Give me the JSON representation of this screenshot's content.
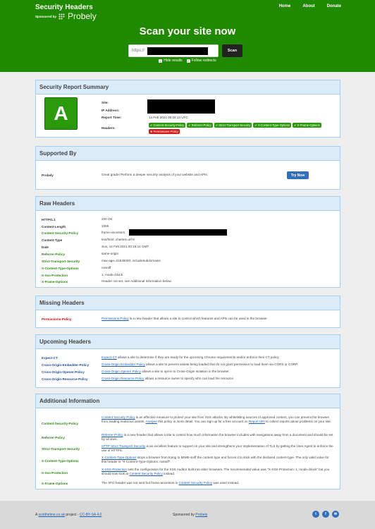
{
  "brand": {
    "title": "Security Headers",
    "sponsored": "Sponsored by",
    "probely": "Probely"
  },
  "nav": [
    "Home",
    "About",
    "Donate"
  ],
  "hero": {
    "title": "Scan your site now",
    "input_placeholder": "https://",
    "scan_label": "Scan"
  },
  "options": [
    {
      "label": "Hide results"
    },
    {
      "label": "Follow redirects"
    }
  ],
  "summary": {
    "heading": "Security Report Summary",
    "grade": "A",
    "site_label": "Site:",
    "ip_label": "IP Address:",
    "time_label": "Report Time:",
    "time_value": "14 Feb 2021 00:16:14 UTC",
    "headers_label": "Headers:",
    "badges": [
      {
        "label": "Content-Security-Policy",
        "status": "ok"
      },
      {
        "label": "Referrer-Policy",
        "status": "ok"
      },
      {
        "label": "Strict-Transport-Security",
        "status": "ok"
      },
      {
        "label": "X-Content-Type-Options",
        "status": "ok"
      },
      {
        "label": "X-Frame-Options",
        "status": "ok"
      },
      {
        "label": "Permissions-Policy",
        "status": "bad"
      }
    ]
  },
  "supported": {
    "heading": "Supported By",
    "name": "Probely",
    "text": "Great grade! Perform a deeper security analysis of your website and APIs:",
    "button": "Try Now"
  },
  "raw": {
    "heading": "Raw Headers",
    "rows": [
      {
        "k": "HTTP/1.1",
        "v": "200 OK",
        "c": ""
      },
      {
        "k": "Content-Length",
        "v": "3355",
        "c": ""
      },
      {
        "k": "Content-Security-Policy",
        "v": "frame-ancestors",
        "c": "green"
      },
      {
        "k": "Content-Type",
        "v": "text/html; charset=utf-8",
        "c": ""
      },
      {
        "k": "Date",
        "v": "Sun, 14 Feb 2021 00:16:14 GMT",
        "c": ""
      },
      {
        "k": "Referrer-Policy",
        "v": "same-origin",
        "c": "green"
      },
      {
        "k": "Strict-Transport-Security",
        "v": "max-age=31536000; includeSubdomains",
        "c": "green"
      },
      {
        "k": "X-Content-Type-Options",
        "v": "nosniff",
        "c": "green"
      },
      {
        "k": "X-Xss-Protection",
        "v": "1; mode=block",
        "c": "green"
      },
      {
        "k": "X-Frame-Options",
        "v": "Header not set, see Additional Information below.",
        "c": "green"
      }
    ]
  },
  "missing": {
    "heading": "Missing Headers",
    "key": "Permissions-Policy",
    "link": "Permissions Policy",
    "text": " is a new header that allows a site to control which features and APIs can be used in the browser."
  },
  "upcoming": {
    "heading": "Upcoming Headers",
    "rows": [
      {
        "k": "Expect-CT",
        "link": "Expect-CT",
        "text": " allows a site to determine if they are ready for the upcoming Chrome requirements and/or enforce their CT policy."
      },
      {
        "k": "Cross-Origin-Embedder-Policy",
        "link": "Cross-Origin Embedder Policy",
        "text": " allows a site to prevent assets being loaded that do not grant permission to load them via CORS or CORP."
      },
      {
        "k": "Cross-Origin-Opener-Policy",
        "link": "Cross-Origin Opener Policy",
        "text": " allows a site to opt-in to Cross-Origin Isolation in the browser."
      },
      {
        "k": "Cross-Origin-Resource-Policy",
        "link": "Cross-Origin Resource Policy",
        "text": " allows a resource owner to specify who can load the resource."
      }
    ]
  },
  "additional": {
    "heading": "Additional Information",
    "csp": {
      "k": "Content-Security-Policy",
      "l1": "Content Security Policy",
      "t1": " is an effective measure to protect your site from XSS attacks. By whitelisting sources of approved content, you can prevent the browser from loading malicious assets. ",
      "l2": "Analyse",
      "t2": " this policy in more detail. You can sign up for a free account on ",
      "l3": "Report URI",
      "t3": " to collect reports about problems on your site."
    },
    "ref": {
      "k": "Referrer-Policy",
      "l1": "Referrer Policy",
      "t1": " is a new header that allows a site to control how much information the browser includes with navigations away from a document and should be set by all sites."
    },
    "sts": {
      "k": "Strict-Transport-Security",
      "l1": "HTTP Strict Transport Security",
      "t1": " is an excellent feature to support on your site and strengthens your implementation of TLS by getting the User Agent to enforce the use of HTTPS."
    },
    "xcto": {
      "k": "X-Content-Type-Options",
      "l1": "X-Content-Type-Options",
      "t1": " stops a browser from trying to MIME-sniff the content type and forces it to stick with the declared content-type. The only valid value for this header is \"X-Content-Type-Options: nosniff\"."
    },
    "xxss": {
      "k": "X-Xss-Protection",
      "l1": "X-XSS-Protection",
      "t1": " sets the configuration for the XSS Auditor built into older browsers. The recommended value was \"X-XSS-Protection: 1; mode=block\" but you should now look at ",
      "l2": "Content Security Policy",
      "t2": " instead."
    },
    "xfo": {
      "k": "X-Frame-Options",
      "t1": "The XFO header was not sent but frame-ancestors in ",
      "l1": "Content Security Policy",
      "t2": " was used instead."
    }
  },
  "footer": {
    "a": "A ",
    "author": "scotthelme.co.uk",
    "project": " project - ",
    "license": "CC-BY-SA 4.0",
    "sponsored": "Sponsored by ",
    "sponsor": "Probely"
  }
}
